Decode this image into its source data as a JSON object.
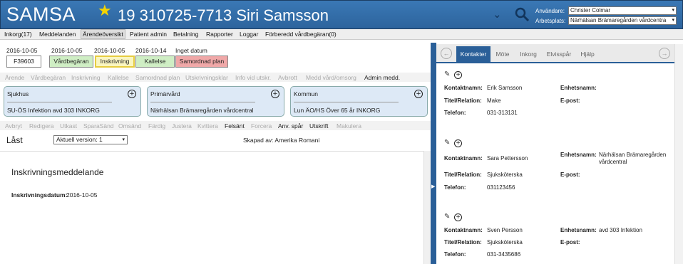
{
  "header": {
    "app_title": "SAMSA",
    "patient": "19 310725-7713 Siri Samsson",
    "user_label": "Användare:",
    "user_value": "Christer Colmar",
    "workplace_label": "Arbetsplats:",
    "workplace_value": "Närhälsan Brämaregården vårdcentra"
  },
  "menu": [
    "Inkorg(17)",
    "Meddelanden",
    "Ärendeöversikt",
    "Patient admin",
    "Betalning",
    "Rapporter",
    "Loggar",
    "Förberedd vårdbegäran(0)"
  ],
  "status_dates": [
    "2016-10-05",
    "2016-10-05",
    "2016-10-05",
    "2016-10-14",
    "Inget datum"
  ],
  "status_boxes": [
    "F39603",
    "Vårdbegäran",
    "Inskrivning",
    "Kallelse",
    "Samordnad plan"
  ],
  "toolbar1": [
    "Ärende",
    "Vårdbegäran",
    "Inskrivning",
    "Kallelse",
    "Samordnad plan",
    "Utskrivningsklar",
    "Info vid utskr.",
    "Avbrott",
    "Medd vård/omsorg",
    "Admin medd."
  ],
  "orgs": [
    {
      "title": "Sjukhus",
      "value": "SU-ÖS Infektion avd 303 INKORG"
    },
    {
      "title": "Primärvård",
      "value": "Närhälsan Brämaregården vårdcentral"
    },
    {
      "title": "Kommun",
      "value": "Lun ÄO/HS Över 65 år INKORG"
    }
  ],
  "toolbar2": [
    "Avbryt",
    "Redigera",
    "Utkast",
    "SparaSänd",
    "Omsänd",
    "Färdig",
    "Justera",
    "Kvittera",
    "Felsänt",
    "Forcera",
    "Anv. spår",
    "Utskrift",
    "Makulera"
  ],
  "doc": {
    "locked": "Låst",
    "version": "Aktuell version: 1",
    "created_by": "Skapad av: Amerika Romani",
    "title": "Inskrivningsmeddelande",
    "date_label": "Inskrivningsdatum:",
    "date_value": "2016-10-05"
  },
  "right_tabs": [
    "Kontakter",
    "Möte",
    "Inkorg",
    "Elvisspår",
    "Hjälp"
  ],
  "labels": {
    "name": "Kontaktnamn:",
    "title": "Titel/Relation:",
    "phone": "Telefon:",
    "unit": "Enhetsnamn:",
    "email": "E-post:"
  },
  "contacts": [
    {
      "name": "Erik Samsson",
      "title": "Make",
      "phone": "031-313131",
      "unit": "",
      "unit2": ""
    },
    {
      "name": "Sara Pettersson",
      "title": "Sjuksköterska",
      "phone": "031123456",
      "unit": "Närhälsan Brämaregården",
      "unit2": "vårdcentral"
    },
    {
      "name": "Sven Persson",
      "title": "Sjuksköterska",
      "phone": "031-3435686",
      "unit": "avd 303 Infektion",
      "unit2": ""
    }
  ]
}
